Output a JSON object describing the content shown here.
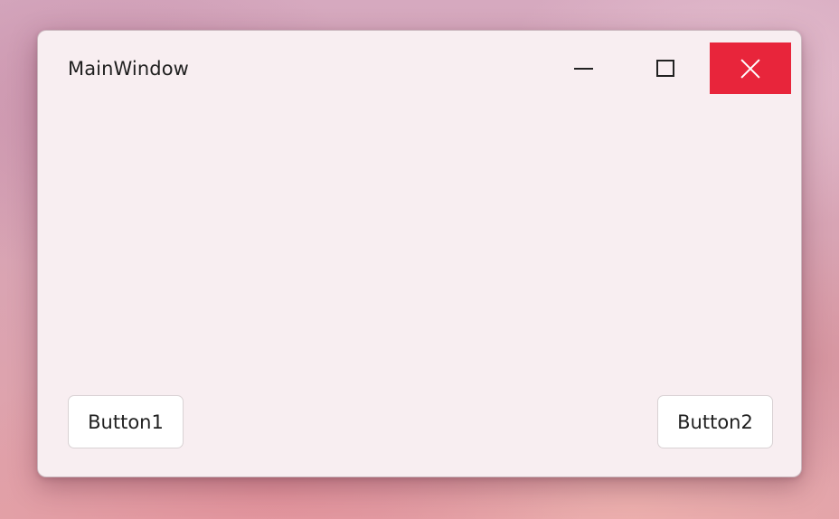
{
  "window": {
    "title": "MainWindow",
    "accent_close_color": "#e8253b",
    "background_color": "#f8eef1"
  },
  "caption_buttons": {
    "minimize_icon": "minimize-icon",
    "maximize_icon": "maximize-icon",
    "close_icon": "close-icon"
  },
  "content": {
    "button1_label": "Button1",
    "button2_label": "Button2"
  }
}
